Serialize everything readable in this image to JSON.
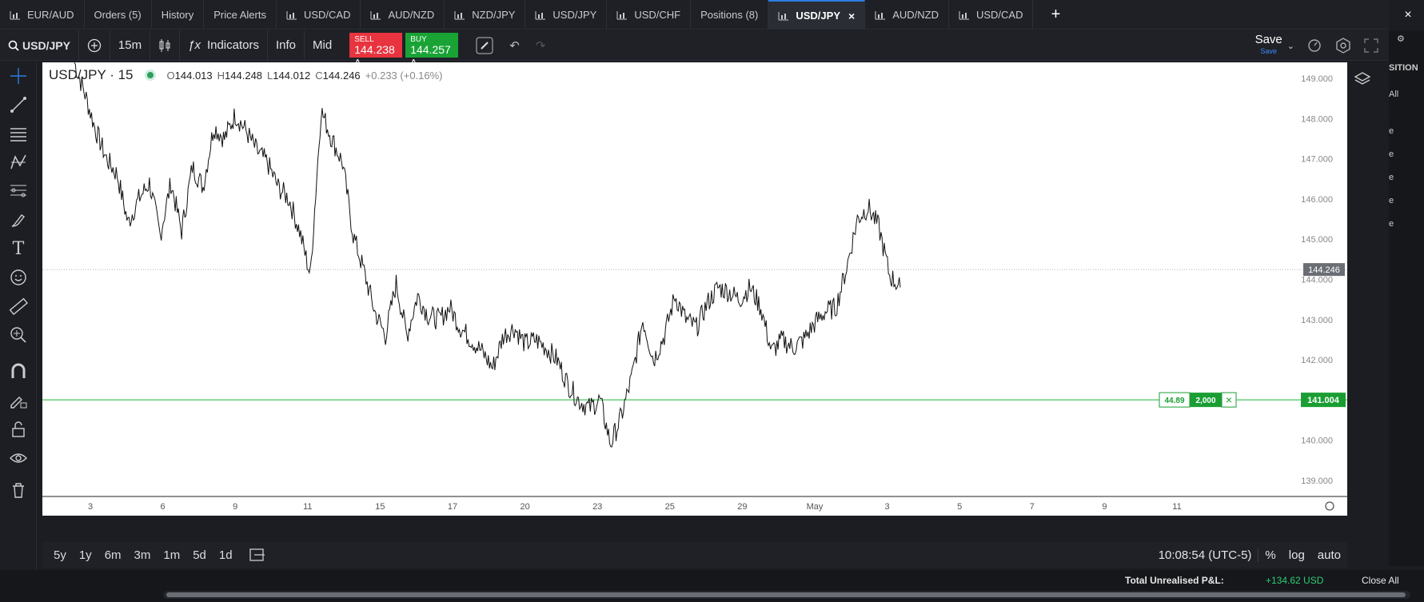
{
  "tabs": [
    {
      "label": "EUR/AUD",
      "icon": "chart-icon"
    },
    {
      "label": "Orders (5)"
    },
    {
      "label": "History"
    },
    {
      "label": "Price Alerts"
    },
    {
      "label": "USD/CAD",
      "icon": "chart-icon"
    },
    {
      "label": "AUD/NZD",
      "icon": "chart-icon"
    },
    {
      "label": "NZD/JPY",
      "icon": "chart-icon"
    },
    {
      "label": "USD/JPY",
      "icon": "chart-icon"
    },
    {
      "label": "USD/CHF",
      "icon": "chart-icon"
    },
    {
      "label": "Positions (8)"
    },
    {
      "label": "USD/JPY",
      "icon": "chart-icon",
      "active": true,
      "close": "×"
    },
    {
      "label": "AUD/NZD",
      "icon": "chart-icon"
    },
    {
      "label": "USD/CAD",
      "icon": "chart-icon"
    }
  ],
  "tab_add": "+",
  "tab_close_all": "×",
  "toolbar": {
    "symbol": "USD/JPY",
    "interval": "15m",
    "indicators": "Indicators",
    "info": "Info",
    "mid": "Mid",
    "sell_label": "SELL",
    "sell_price": "144.238",
    "buy_label": "BUY",
    "buy_price": "144.257",
    "save": "Save",
    "save_sub": "Save"
  },
  "legend": {
    "title": "USD/JPY · 15",
    "o_label": "O",
    "o": "144.013",
    "h_label": "H",
    "h": "144.248",
    "l_label": "L",
    "l": "144.012",
    "c_label": "C",
    "c": "144.246",
    "change": "+0.233 (+0.16%)"
  },
  "chart_data": {
    "type": "line",
    "yaxis_ticks": [
      "149.000",
      "148.000",
      "147.000",
      "146.000",
      "145.000",
      "144.000",
      "143.000",
      "142.000",
      "141.000",
      "140.000",
      "139.000"
    ],
    "ylim": [
      138.6,
      149.4
    ],
    "xaxis_ticks": [
      "3",
      "6",
      "9",
      "11",
      "15",
      "17",
      "20",
      "23",
      "25",
      "29",
      "May",
      "3",
      "5",
      "7",
      "9",
      "11"
    ],
    "current_price": "144.246",
    "order_line": {
      "price": "141.004",
      "pnl": "44.89",
      "qty": "2,000",
      "close": "×"
    },
    "series": [
      {
        "values": [
          149.4,
          148.6,
          147.7,
          147.0,
          146.6,
          145.4,
          146.0,
          146.4,
          145.1,
          146.4,
          145.2,
          146.8,
          146.3,
          147.8,
          147.5,
          148.1,
          147.7,
          147.2,
          146.9,
          146.3,
          146.0,
          145.2,
          144.1,
          148.2,
          147.5,
          146.9,
          145.1,
          144.2,
          143.2,
          142.6,
          143.9,
          142.6,
          143.6,
          143.1,
          143.0,
          143.3,
          142.8,
          142.5,
          142.2,
          141.8,
          142.6,
          142.8,
          142.4,
          142.5,
          142.3,
          142.0,
          141.4,
          141.0,
          140.8,
          141.0,
          139.9,
          140.6,
          141.6,
          143.0,
          142.0,
          142.6,
          143.6,
          143.0,
          142.8,
          143.4,
          143.8,
          143.7,
          143.5,
          143.8,
          143.3,
          142.2,
          142.5,
          142.3,
          142.5,
          142.9,
          143.2,
          143.3,
          144.3,
          145.5,
          145.8,
          145.3,
          144.1,
          143.8
        ]
      }
    ]
  },
  "bottombar": {
    "ranges": [
      "5y",
      "1y",
      "6m",
      "3m",
      "1m",
      "5d",
      "1d"
    ],
    "clock": "10:08:54 (UTC-5)",
    "pct": "%",
    "log": "log",
    "auto": "auto"
  },
  "rightstrip": {
    "header": "SITION",
    "all": "All",
    "items": [
      "e",
      "e",
      "e",
      "e",
      "e"
    ]
  },
  "pnl": {
    "label": "Total Unrealised P&L:",
    "value": "+134.62 USD",
    "close_all": "Close All"
  },
  "colors": {
    "sell": "#e8343f",
    "buy": "#19a335",
    "order_line": "#1fb33a",
    "accent": "#2f7de1"
  }
}
